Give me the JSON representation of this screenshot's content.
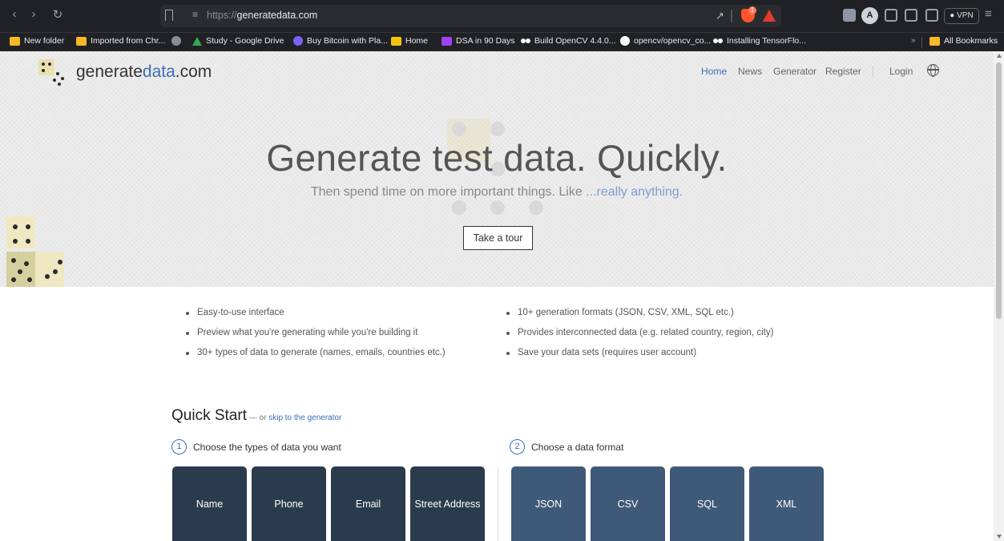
{
  "browser": {
    "url_protocol": "https://",
    "url_host": "generatedata.com",
    "shield_badge": "1",
    "profile_initial": "A",
    "vpn_label": "VPN",
    "bookmarks": [
      {
        "label": "New folder",
        "icon": "folder-icon"
      },
      {
        "label": "Imported from Chr...",
        "icon": "folder-icon"
      },
      {
        "label": "",
        "icon": "globe-icon"
      },
      {
        "label": "Study - Google Drive",
        "icon": "drive-icon"
      },
      {
        "label": "Buy Bitcoin with Pla...",
        "icon": "coin-icon"
      },
      {
        "label": "Home",
        "icon": "home-icon"
      },
      {
        "label": "DSA in 90 Days",
        "icon": "dsa-icon"
      },
      {
        "label": "Build OpenCV 4.4.0...",
        "icon": "dots-icon"
      },
      {
        "label": "opencv/opencv_co...",
        "icon": "github-icon"
      },
      {
        "label": "Installing TensorFlo...",
        "icon": "dots-icon"
      }
    ],
    "bookmarks_more": "»",
    "all_bookmarks": "All Bookmarks"
  },
  "site": {
    "logo_text_main": "generate",
    "logo_text_accent": "data",
    "logo_text_tail": ".com",
    "nav": {
      "home": "Home",
      "news": "News",
      "generator": "Generator",
      "register": "Register",
      "login": "Login"
    },
    "hero": {
      "title": "Generate test data. Quickly.",
      "subtitle_main": "Then spend time on more important things. Like ",
      "subtitle_link": "...really anything.",
      "tour_button": "Take a tour"
    },
    "features_left": [
      "Easy-to-use interface",
      "Preview what you're generating while you're building it",
      "30+ types of data to generate (names, emails, countries etc.)"
    ],
    "features_right": [
      "10+ generation formats (JSON, CSV, XML, SQL etc.)",
      "Provides interconnected data (e.g. related country, region, city)",
      "Save your data sets (requires user account)"
    ],
    "quick_start": {
      "title": "Quick Start",
      "or_text": " — or ",
      "skip_link": "skip to the generator",
      "step1_num": "1",
      "step1_label": "Choose the types of data you want",
      "step2_num": "2",
      "step2_label": "Choose a data format",
      "types": [
        "Name",
        "Phone",
        "Email",
        "Street Address"
      ],
      "formats": [
        "JSON",
        "CSV",
        "SQL",
        "XML"
      ]
    }
  }
}
